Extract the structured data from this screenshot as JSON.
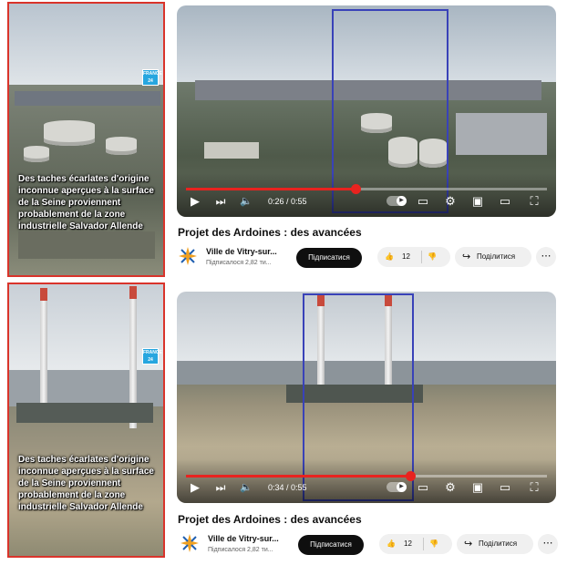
{
  "left_panels": [
    {
      "caption": "Des taches écarlates d'origine inconnue aperçues à la surface de la Seine proviennent probablement de la zone industrielle Salvador Allende",
      "logo": "FRANCE 24"
    },
    {
      "caption": "Des taches écarlates d'origine inconnue aperçues à la surface de la Seine proviennent probablement de la zone industrielle Salvador Allende",
      "logo": "FRANCE 24"
    }
  ],
  "videos": [
    {
      "time": "0:26 / 0:55",
      "progress": 0.47,
      "title": "Projet des Ardoines : des avancées",
      "channel": "Ville de Vitry-sur...",
      "subscribers": "Підписалося 2,82 ти...",
      "subscribe_label": "Підписатися",
      "likes": "12",
      "share_label": "Поділитися"
    },
    {
      "time": "0:34 / 0:55",
      "progress": 0.62,
      "title": "Projet des Ardoines : des avancées",
      "channel": "Ville de Vitry-sur...",
      "subscribers": "Підписалося 2,82 ти...",
      "subscribe_label": "Підписатися",
      "likes": "12",
      "share_label": "Поділитися"
    }
  ],
  "icons": {
    "play": "▶",
    "next": "⏭",
    "volume": "🔈",
    "subtitles": "▭",
    "settings": "⚙",
    "miniplayer": "▣",
    "theater": "▭",
    "fullscreen": "⛶",
    "like": "👍",
    "dislike": "👎",
    "share": "↪",
    "more": "⋯"
  },
  "colors": {
    "red_frame": "#d9342b",
    "blue_box": "#3942b8",
    "progress_red": "#e8231f",
    "subscribe_bg": "#0f0f0f",
    "france24_blue": "#27a6df"
  }
}
